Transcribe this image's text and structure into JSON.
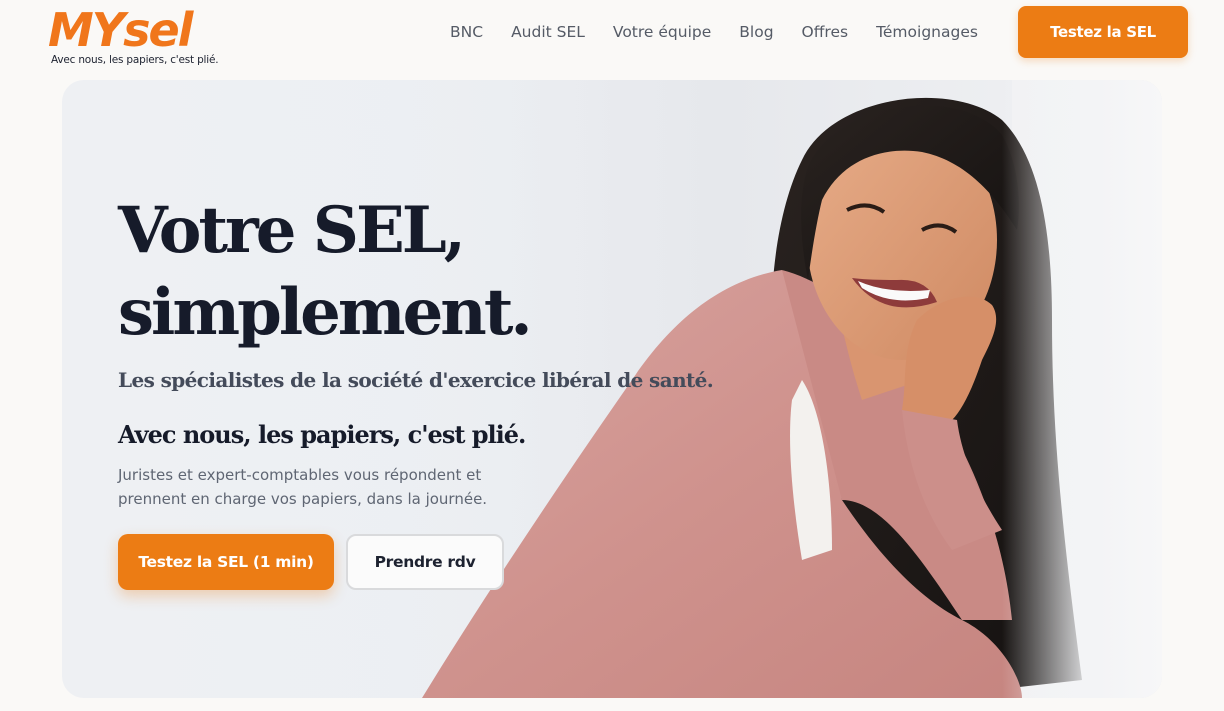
{
  "brand": {
    "name": "MYsel",
    "tagline": "Avec nous, les papiers, c'est plié.",
    "accent": "#ec7c14"
  },
  "nav": {
    "items": [
      {
        "label": "BNC"
      },
      {
        "label": "Audit SEL"
      },
      {
        "label": "Votre équipe"
      },
      {
        "label": "Blog"
      },
      {
        "label": "Offres"
      },
      {
        "label": "Témoignages"
      }
    ],
    "cta_label": "Testez la SEL"
  },
  "hero": {
    "title_line1": "Votre SEL,",
    "title_line2": "simplement.",
    "subtitle": "Les spécialistes de la société d'exercice libéral de santé.",
    "tagline": "Avec nous, les papiers, c'est plié.",
    "description": "Juristes et expert-comptables vous répondent et prennent en charge vos papiers, dans la journée.",
    "primary_button": "Testez la SEL (1 min)",
    "secondary_button": "Prendre rdv",
    "photo_icon": "smiling-woman-photo"
  }
}
